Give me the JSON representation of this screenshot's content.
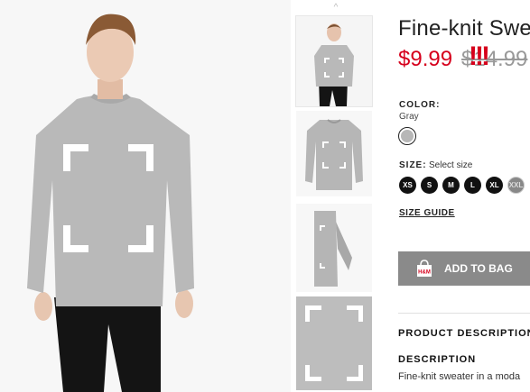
{
  "product": {
    "title": "Fine-knit Swe",
    "price": "$9.99",
    "old_price": "$14.99",
    "promo_mark": "!!!"
  },
  "color": {
    "label": "COLOR:",
    "value": "Gray",
    "swatch_hex": "#b7b7b7"
  },
  "size": {
    "label": "SIZE:",
    "hint": "Select size",
    "options": [
      "XS",
      "S",
      "M",
      "L",
      "XL",
      "XXL"
    ],
    "unavailable": [
      "XXL"
    ],
    "guide_label": "SIZE GUIDE"
  },
  "actions": {
    "add_to_bag": "ADD TO BAG",
    "bag_logo_text": "H&M"
  },
  "details": {
    "section_title": "PRODUCT DESCRIPTION",
    "heading": "DESCRIPTION",
    "text": "Fine-knit sweater in a moda"
  },
  "gallery": {
    "thumbnails": [
      "model-front",
      "sweater-flat",
      "sweater-folded",
      "fabric-detail"
    ],
    "up_arrow": "^"
  },
  "colors": {
    "accent_red": "#d6001c",
    "button_gray": "#8a8a8a"
  }
}
